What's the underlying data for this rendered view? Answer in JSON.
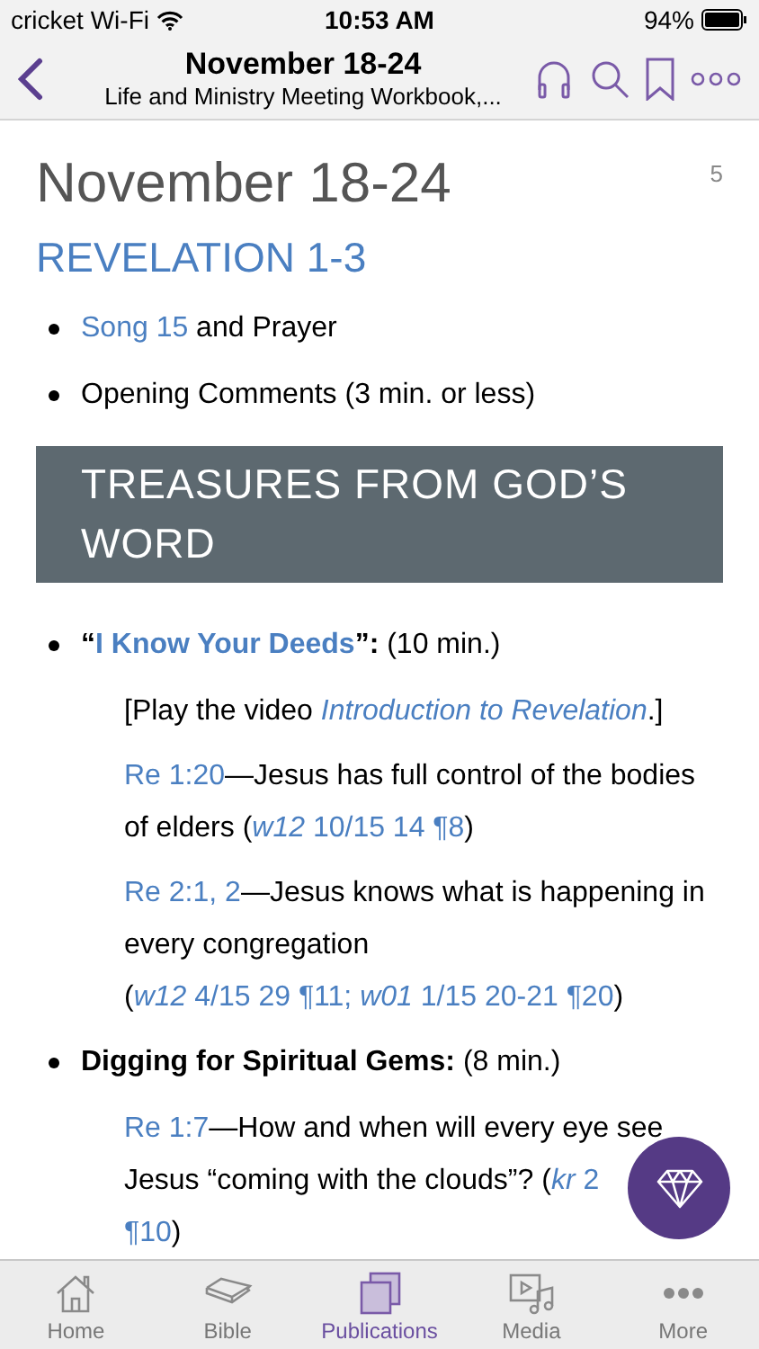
{
  "status_bar": {
    "carrier": "cricket Wi-Fi",
    "time": "10:53 AM",
    "battery": "94%"
  },
  "header": {
    "title": "November 18-24",
    "subtitle": "Life and Ministry Meeting Workbook,..."
  },
  "article": {
    "title": "November 18-24",
    "page_number": "5",
    "subtitle": "REVELATION 1-3",
    "blocks": [
      {
        "kind": "bullet",
        "segments": [
          {
            "kind": "link",
            "text": "Song 15"
          },
          {
            "kind": "text",
            "text": " and Prayer"
          }
        ]
      },
      {
        "kind": "bullet",
        "segments": [
          {
            "kind": "text",
            "text": "Opening Comments (3 min. or less)"
          }
        ]
      },
      {
        "kind": "banner",
        "text": "TREASURES FROM GOD’S WORD"
      },
      {
        "kind": "bullet",
        "segments": [
          {
            "kind": "bold",
            "text": "“"
          },
          {
            "kind": "link-bold",
            "text": "I Know Your Deeds"
          },
          {
            "kind": "bold",
            "text": "”:"
          },
          {
            "kind": "text",
            "text": " (10 min.)"
          }
        ]
      },
      {
        "kind": "sub",
        "segments": [
          {
            "kind": "text",
            "text": "[Play the video "
          },
          {
            "kind": "link-italic",
            "text": "Introduction to Revelation"
          },
          {
            "kind": "text",
            "text": ".]"
          }
        ]
      },
      {
        "kind": "sub",
        "segments": [
          {
            "kind": "link",
            "text": "Re 1:20"
          },
          {
            "kind": "text",
            "text": "—Jesus has full control of the bodies of elders ("
          },
          {
            "kind": "link-italic",
            "text": "w12"
          },
          {
            "kind": "link",
            "text": " 10/15 14 ¶8"
          },
          {
            "kind": "text",
            "text": ")"
          }
        ]
      },
      {
        "kind": "sub",
        "segments": [
          {
            "kind": "link",
            "text": "Re 2:1, 2"
          },
          {
            "kind": "text",
            "text": "—Jesus knows what is happening in every congregation ("
          },
          {
            "kind": "link-italic",
            "text": "w12"
          },
          {
            "kind": "link",
            "text": " 4/15 29 ¶11; "
          },
          {
            "kind": "link-italic",
            "text": "w01"
          },
          {
            "kind": "link",
            "text": " 1/15 20-21 ¶20"
          },
          {
            "kind": "text",
            "text": ")"
          }
        ]
      },
      {
        "kind": "bullet",
        "segments": [
          {
            "kind": "bold",
            "text": "Digging for Spiritual Gems:"
          },
          {
            "kind": "text",
            "text": " (8 min.)"
          }
        ]
      },
      {
        "kind": "sub",
        "segments": [
          {
            "kind": "link",
            "text": "Re 1:7"
          },
          {
            "kind": "text",
            "text": "—How and when will every eye see Jesus “coming with the clouds”? ("
          },
          {
            "kind": "link-italic",
            "text": "kr"
          },
          {
            "kind": "link",
            "text": " 2"
          },
          {
            "kind": "break"
          },
          {
            "kind": "link",
            "text": "¶10"
          },
          {
            "kind": "text",
            "text": ")"
          }
        ]
      }
    ]
  },
  "tab_bar": [
    {
      "label": "Home",
      "selected": false
    },
    {
      "label": "Bible",
      "selected": false
    },
    {
      "label": "Publications",
      "selected": true
    },
    {
      "label": "Media",
      "selected": false
    },
    {
      "label": "More",
      "selected": false
    }
  ]
}
